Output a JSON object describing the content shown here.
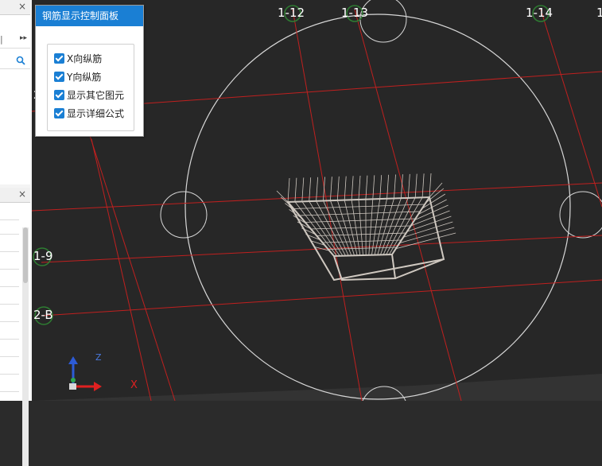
{
  "panel": {
    "title": "钢筋显示控制面板",
    "options": [
      {
        "label": "X向纵筋",
        "checked": true
      },
      {
        "label": "Y向纵筋",
        "checked": true
      },
      {
        "label": "显示其它图元",
        "checked": true
      },
      {
        "label": "显示详细公式",
        "checked": true
      }
    ]
  },
  "grid_labels": {
    "a": "1-12",
    "b": "1-13",
    "c": "1-14",
    "d": "1",
    "e": "1-9",
    "f": "2-B",
    "g": "2"
  },
  "left": {
    "close1": "×",
    "close2": "×",
    "expand": "▸▸",
    "search_icon": "search-icon",
    "tab_marker": "|"
  },
  "axis": {
    "x": "X",
    "z": "Z"
  },
  "colors": {
    "grid_line": "#c0201f",
    "panel_title": "#1a7fd4",
    "background": "#272727"
  }
}
